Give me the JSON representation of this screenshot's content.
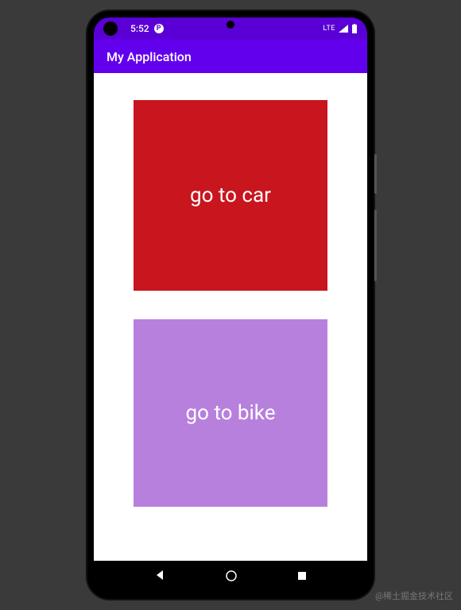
{
  "status": {
    "time": "5:52",
    "network": "LTE",
    "icon_label": "P"
  },
  "app_bar": {
    "title": "My Application"
  },
  "tiles": {
    "car": {
      "label": "go to car"
    },
    "bike": {
      "label": "go to bike"
    }
  },
  "watermark": "@稀土掘金技术社区"
}
